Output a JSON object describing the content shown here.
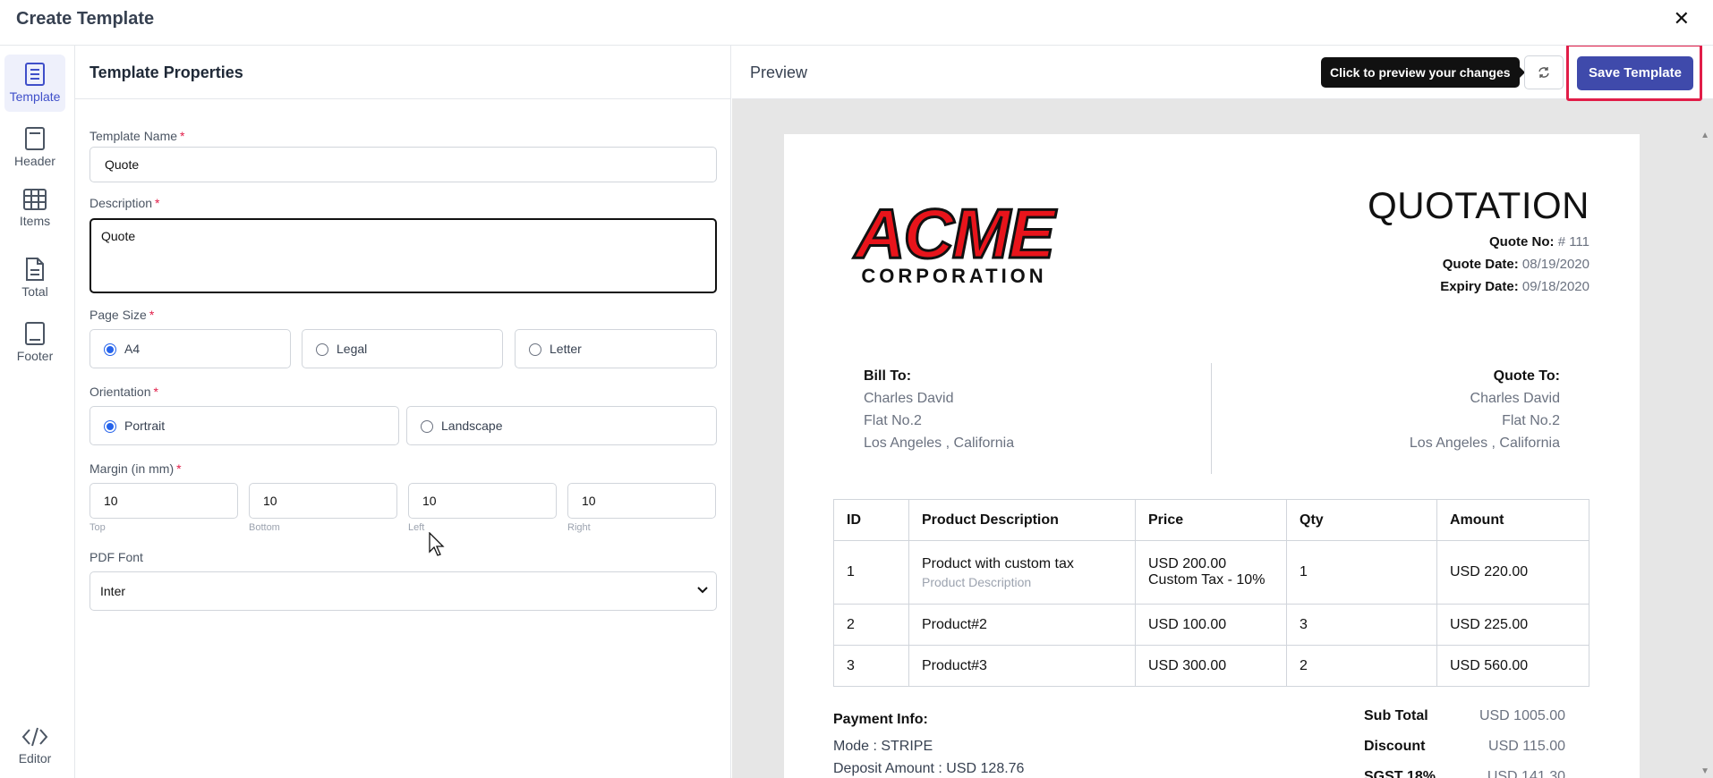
{
  "window": {
    "title": "Create Template"
  },
  "rail": {
    "items": [
      {
        "label": "Template"
      },
      {
        "label": "Header"
      },
      {
        "label": "Items"
      },
      {
        "label": "Total"
      },
      {
        "label": "Footer"
      },
      {
        "label": "Editor"
      }
    ]
  },
  "props": {
    "heading": "Template Properties",
    "template_name": {
      "label": "Template Name",
      "value": "Quote"
    },
    "description": {
      "label": "Description",
      "value": "Quote"
    },
    "page_size": {
      "label": "Page Size",
      "options": [
        "A4",
        "Legal",
        "Letter"
      ],
      "selected": "A4"
    },
    "orientation": {
      "label": "Orientation",
      "options": [
        "Portrait",
        "Landscape"
      ],
      "selected": "Portrait"
    },
    "margin": {
      "label": "Margin (in mm)",
      "fields": [
        {
          "value": "10",
          "sub": "Top"
        },
        {
          "value": "10",
          "sub": "Bottom"
        },
        {
          "value": "10",
          "sub": "Left"
        },
        {
          "value": "10",
          "sub": "Right"
        }
      ]
    },
    "pdf_font": {
      "label": "PDF Font",
      "value": "Inter"
    }
  },
  "preview": {
    "title": "Preview",
    "tooltip": "Click to preview your changes",
    "save_label": "Save Template",
    "doc": {
      "heading": "QUOTATION",
      "logo_line1": "ACME",
      "logo_line2": "CORPORATION",
      "meta": [
        {
          "k": "Quote No:",
          "v": "# 111"
        },
        {
          "k": "Quote Date:",
          "v": "08/19/2020"
        },
        {
          "k": "Expiry Date:",
          "v": "09/18/2020"
        }
      ],
      "bill_to": {
        "title": "Bill To:",
        "lines": [
          "Charles David",
          "Flat No.2",
          "Los Angeles , California"
        ]
      },
      "quote_to": {
        "title": "Quote To:",
        "lines": [
          "Charles David",
          "Flat No.2",
          "Los Angeles , California"
        ]
      },
      "table": {
        "headers": [
          "ID",
          "Product Description",
          "Price",
          "Qty",
          "Amount"
        ],
        "rows": [
          {
            "id": "1",
            "name": "Product with custom tax",
            "desc": "Product Description",
            "price": "USD 200.00",
            "price2": "Custom Tax - 10%",
            "qty": "1",
            "amount": "USD 220.00"
          },
          {
            "id": "2",
            "name": "Product#2",
            "desc": "",
            "price": "USD 100.00",
            "price2": "",
            "qty": "3",
            "amount": "USD 225.00"
          },
          {
            "id": "3",
            "name": "Product#3",
            "desc": "",
            "price": "USD 300.00",
            "price2": "",
            "qty": "2",
            "amount": "USD 560.00"
          }
        ]
      },
      "payment": {
        "title": "Payment Info:",
        "lines": [
          "Mode : STRIPE",
          "Deposit Amount : USD 128.76"
        ]
      },
      "totals": [
        {
          "k": "Sub Total",
          "v": "USD 1005.00"
        },
        {
          "k": "Discount",
          "v": "USD 115.00"
        },
        {
          "k": "SGST 18%",
          "v": "USD 141.30"
        }
      ]
    }
  }
}
